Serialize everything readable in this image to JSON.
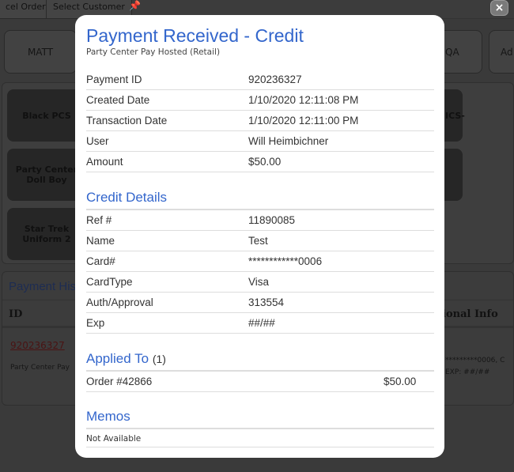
{
  "background": {
    "toolbar": [
      "cel Order",
      "Select Customer"
    ],
    "top_buttons": [
      "MATT",
      "QA",
      "Ad"
    ],
    "products": [
      "Black PCS",
      "Party Center Doll Boy",
      "Star Trek Uniform 2",
      "ICS-"
    ],
    "payment_history": {
      "title": "Payment His",
      "col_id": "ID",
      "col_info": "tional Info",
      "row": {
        "id": "920236327",
        "sub": "Party Center Pay",
        "info1": "*********0006, C",
        "info2": "EXP: ##/##"
      }
    }
  },
  "modal": {
    "close": "×",
    "title": "Payment Received - Credit",
    "subtitle": "Party Center Pay Hosted (Retail)",
    "details": [
      {
        "label": "Payment ID",
        "value": "920236327"
      },
      {
        "label": "Created Date",
        "value": "1/10/2020 12:11:08 PM"
      },
      {
        "label": "Transaction Date",
        "value": "1/10/2020 12:11:00 PM"
      },
      {
        "label": "User",
        "value": "Will Heimbichner"
      },
      {
        "label": "Amount",
        "value": "$50.00"
      }
    ],
    "credit_title": "Credit Details",
    "credit": [
      {
        "label": "Ref #",
        "value": "11890085"
      },
      {
        "label": "Name",
        "value": "Test"
      },
      {
        "label": "Card#",
        "value": "************0006"
      },
      {
        "label": "CardType",
        "value": "Visa"
      },
      {
        "label": "Auth/Approval",
        "value": "313554"
      },
      {
        "label": "Exp",
        "value": "##/##"
      }
    ],
    "applied_title": "Applied To",
    "applied_count": "(1)",
    "applied": [
      {
        "label": "Order #42866",
        "value": "$50.00"
      }
    ],
    "memos_title": "Memos",
    "memos": "Not Available"
  }
}
